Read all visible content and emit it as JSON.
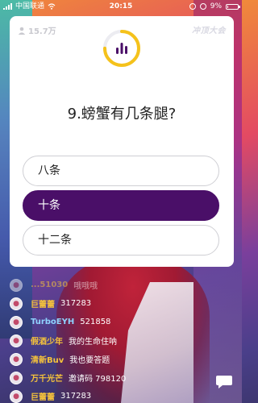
{
  "status_bar": {
    "carrier": "中国联通",
    "time": "20:15",
    "battery": "9%",
    "battery_level": 0.09
  },
  "card": {
    "viewers": "15.7万",
    "brand": "冲顶大会",
    "question": "9.螃蟹有几条腿?",
    "timer_progress": 0.75,
    "options": [
      {
        "label": "八条",
        "selected": false
      },
      {
        "label": "十条",
        "selected": true
      },
      {
        "label": "十二条",
        "selected": false
      }
    ]
  },
  "comments": [
    {
      "name": "...51030",
      "text": "哦哦哦",
      "name_color": "#f5c33b"
    },
    {
      "name": "巨蕾蕾",
      "text": "317283",
      "name_color": "#f5c33b"
    },
    {
      "name": "TurboEYH",
      "text": "521858",
      "name_color": "#8fd3ff"
    },
    {
      "name": "假酒少年",
      "text": "我的生命住呐",
      "name_color": "#f5c33b"
    },
    {
      "name": "清新Buv",
      "text": "我也要答题",
      "name_color": "#f5c33b"
    },
    {
      "name": "万千光芒",
      "text": "邀请码 798120",
      "name_color": "#f5c33b"
    },
    {
      "name": "巨蕾蕾",
      "text": "317283",
      "name_color": "#f5c33b"
    }
  ],
  "icons": {
    "viewers": "person-icon",
    "chat": "chat-bubble-icon",
    "timer": "timer-bars-icon"
  },
  "colors": {
    "accent": "#4a0f68",
    "timer_ring": "#f5c21b"
  }
}
